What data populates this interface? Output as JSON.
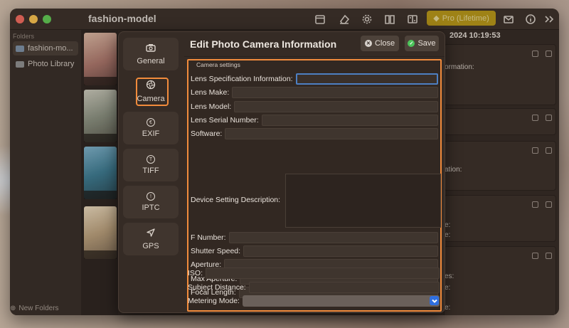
{
  "app": {
    "title": "fashion-model",
    "pro_label": "Pro (Lifetime)"
  },
  "sidebar": {
    "header": "Folders",
    "items": [
      {
        "label": "fashion-mo...",
        "active": true
      },
      {
        "label": "Photo Library",
        "active": false
      }
    ],
    "new_folders": "New Folders"
  },
  "info": {
    "date": "2024 10:19:53",
    "lines": [
      "ormation:",
      "ation:",
      "e:",
      "e:",
      "es:",
      "e:",
      "e:"
    ]
  },
  "modal": {
    "title": "Edit Photo Camera Information",
    "close_label": "Close",
    "save_label": "Save",
    "nav": [
      {
        "label": "General",
        "icon": "camera-icon"
      },
      {
        "label": "Camera",
        "icon": "aperture-icon",
        "active": true
      },
      {
        "label": "EXIF",
        "icon": "exif-icon"
      },
      {
        "label": "TIFF",
        "icon": "tiff-icon"
      },
      {
        "label": "IPTC",
        "icon": "info-icon"
      },
      {
        "label": "GPS",
        "icon": "location-arrow-icon"
      }
    ],
    "group_label": "Camera settings",
    "fields": {
      "lens_spec": {
        "label": "Lens Specification Information:",
        "value": ""
      },
      "lens_make": {
        "label": "Lens Make:",
        "value": ""
      },
      "lens_model": {
        "label": "Lens Model:",
        "value": ""
      },
      "lens_serial": {
        "label": "Lens Serial Number:",
        "value": ""
      },
      "software": {
        "label": "Software:",
        "value": ""
      },
      "device_setting": {
        "label": "Device Setting Description:",
        "value": ""
      },
      "f_number": {
        "label": "F Number:",
        "value": ""
      },
      "shutter_speed": {
        "label": "Shutter Speed:",
        "value": ""
      },
      "aperture": {
        "label": "Aperture:",
        "value": ""
      },
      "max_aperture": {
        "label": "Max Aperture:",
        "value": ""
      },
      "focal_length": {
        "label": "Focal Length:",
        "value": ""
      },
      "iso": {
        "label": "ISO:",
        "value": ""
      },
      "subject_distance": {
        "label": "Subject Distance:",
        "value": ""
      },
      "metering_mode": {
        "label": "Metering Mode:",
        "value": ""
      }
    }
  }
}
